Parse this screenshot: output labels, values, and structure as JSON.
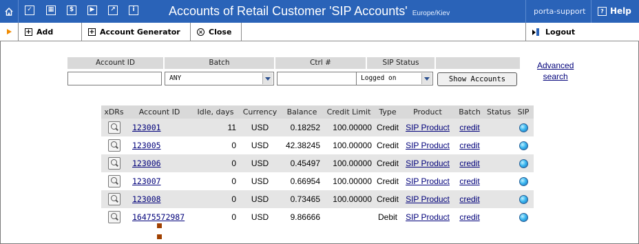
{
  "titlebar": {
    "title": "Accounts of Retail Customer 'SIP Accounts'",
    "timezone": "Europe/Kiev",
    "user": "porta-support",
    "help": "Help"
  },
  "toolbar": {
    "add": "Add",
    "generator": "Account Generator",
    "close": "Close",
    "logout": "Logout"
  },
  "search": {
    "headers": [
      "Account ID",
      "Batch",
      "Ctrl #",
      "SIP Status"
    ],
    "account_id_value": "",
    "batch_value": "ANY",
    "ctrl_value": "",
    "sip_status_value": "Logged on",
    "show_button": "Show Accounts",
    "advanced_line1": "Advanced",
    "advanced_line2": "search"
  },
  "table": {
    "headers": [
      "xDRs",
      "Account ID",
      "Idle, days",
      "Currency",
      "Balance",
      "Credit Limit",
      "Type",
      "Product",
      "Batch",
      "Status",
      "SIP"
    ],
    "rows": [
      {
        "id": "123001",
        "idle": "11",
        "currency": "USD",
        "balance": "0.18252",
        "credit_limit": "100.00000",
        "type": "Credit",
        "product": "SIP Product",
        "batch": "credit",
        "status": ""
      },
      {
        "id": "123005",
        "idle": "0",
        "currency": "USD",
        "balance": "42.38245",
        "credit_limit": "100.00000",
        "type": "Credit",
        "product": "SIP Product",
        "batch": "credit",
        "status": ""
      },
      {
        "id": "123006",
        "idle": "0",
        "currency": "USD",
        "balance": "0.45497",
        "credit_limit": "100.00000",
        "type": "Credit",
        "product": "SIP Product",
        "batch": "credit",
        "status": ""
      },
      {
        "id": "123007",
        "idle": "0",
        "currency": "USD",
        "balance": "0.66954",
        "credit_limit": "100.00000",
        "type": "Credit",
        "product": "SIP Product",
        "batch": "credit",
        "status": ""
      },
      {
        "id": "123008",
        "idle": "0",
        "currency": "USD",
        "balance": "0.73465",
        "credit_limit": "100.00000",
        "type": "Credit",
        "product": "SIP Product",
        "batch": "credit",
        "status": ""
      },
      {
        "id": "16475572987",
        "idle": "0",
        "currency": "USD",
        "balance": "9.86666",
        "credit_limit": "",
        "type": "Debit",
        "product": "SIP Product",
        "batch": "credit",
        "status": ""
      }
    ]
  },
  "colors": {
    "titlebar_bg": "#2a63b8",
    "header_bg": "#d9d9d9",
    "row_alt_bg": "#e5e5e5",
    "link": "#00007a",
    "toolbar_arrow": "#f08a00"
  },
  "icons": {
    "home": "home-icon",
    "toolbar_arrow": "play-arrow-icon",
    "xdr": "magnifier-icon",
    "sip_status": "sip-online-icon"
  }
}
